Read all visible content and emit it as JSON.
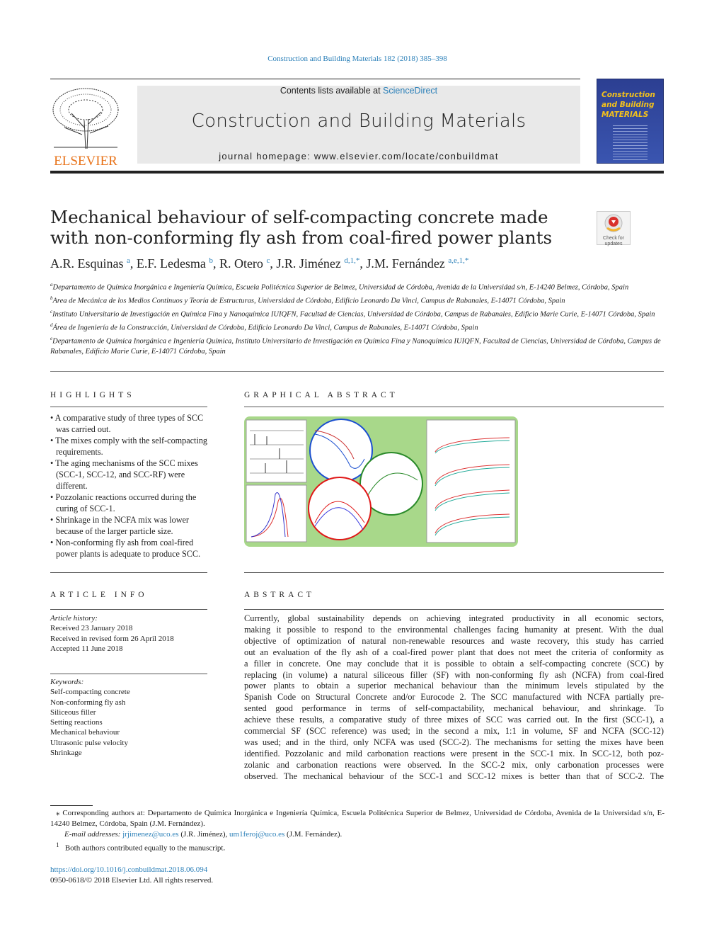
{
  "citation": "Construction and Building Materials 182 (2018) 385–398",
  "header": {
    "contents_prefix": "Contents lists available at ",
    "sciencedirect": "ScienceDirect",
    "journal_title": "Construction and Building Materials",
    "homepage": "journal homepage: www.elsevier.com/locate/conbuildmat",
    "publisher": "ELSEVIER",
    "cover_title": "Construction and Building MATERIALS",
    "updates_badge": "Check for updates"
  },
  "article": {
    "title_line1": "Mechanical behaviour of self-compacting concrete made",
    "title_line2": "with non-conforming fly ash from coal-fired power plants",
    "authors": [
      {
        "name": "A.R. Esquinas",
        "sup": "a"
      },
      {
        "name": "E.F. Ledesma",
        "sup": "b"
      },
      {
        "name": "R. Otero",
        "sup": "c"
      },
      {
        "name": "J.R. Jiménez",
        "sup": "d,1,*"
      },
      {
        "name": "J.M. Fernández",
        "sup": "a,e,1,*"
      }
    ],
    "affiliations": [
      {
        "sup": "a",
        "text": "Departamento de Química Inorgánica e Ingeniería Química, Escuela Politécnica Superior de Belmez, Universidad de Córdoba, Avenida de la Universidad s/n, E-14240 Belmez, Córdoba, Spain"
      },
      {
        "sup": "b",
        "text": "Area de Mecánica de los Medios Continuos y Teoría de Estructuras, Universidad de Córdoba, Edificio Leonardo Da Vinci, Campus de Rabanales, E-14071 Córdoba, Spain"
      },
      {
        "sup": "c",
        "text": "Instituto Universitario de Investigación en Química Fina y Nanoquímica IUIQFN, Facultad de Ciencias, Universidad de Córdoba, Campus de Rabanales, Edificio Marie Curie, E-14071 Córdoba, Spain"
      },
      {
        "sup": "d",
        "text": "Área de Ingeniería de la Construcción, Universidad de Córdoba, Edificio Leonardo Da Vinci, Campus de Rabanales, E-14071 Córdoba, Spain"
      },
      {
        "sup": "e",
        "text": "Departamento de Química Inorgánica e Ingeniería Química, Instituto Universitario de Investigación en Química Fina y Nanoquímica IUIQFN, Facultad de Ciencias, Universidad de Córdoba, Campus de Rabanales, Edificio Marie Curie, E-14071 Córdoba, Spain"
      }
    ]
  },
  "highlights": {
    "heading": "HIGHLIGHTS",
    "items": [
      "A comparative study of three types of SCC was carried out.",
      "The mixes comply with the self-compacting requirements.",
      "The aging mechanisms of the SCC mixes (SCC-1, SCC-12, and SCC-RF) were different.",
      "Pozzolanic reactions occurred during the curing of SCC-1.",
      "Shrinkage in the NCFA mix was lower because of the larger particle size.",
      "Non-conforming fly ash from coal-fired power plants is adequate to produce SCC."
    ]
  },
  "graphical_abstract": {
    "heading": "GRAPHICAL ABSTRACT",
    "background_color": "#a8d88a"
  },
  "article_info": {
    "heading": "ARTICLE INFO",
    "history_label": "Article history:",
    "history": [
      "Received 23 January 2018",
      "Received in revised form 26 April 2018",
      "Accepted 11 June 2018"
    ],
    "keywords_label": "Keywords:",
    "keywords": [
      "Self-compacting concrete",
      "Non-conforming fly ash",
      "Siliceous filler",
      "Setting reactions",
      "Mechanical behaviour",
      "Ultrasonic pulse velocity",
      "Shrinkage"
    ]
  },
  "abstract": {
    "heading": "ABSTRACT",
    "lines": [
      "Currently, global sustainability depends on achieving integrated productivity in all economic sectors,",
      "making it possible to respond to the environmental challenges facing humanity at present. With the dual",
      "objective of optimization of natural non-renewable resources and waste recovery, this study has carried",
      "out an evaluation of the fly ash of a coal-fired power plant that does not meet the criteria of conformity as",
      "a filler in concrete. One may conclude that it is possible to obtain a self-compacting concrete (SCC) by",
      "replacing (in volume) a natural siliceous filler (SF) with non-conforming fly ash (NCFA) from coal-fired",
      "power plants to obtain a superior mechanical behaviour than the minimum levels stipulated by the",
      "Spanish Code on Structural Concrete and/or Eurocode 2. The SCC manufactured with NCFA partially pre-",
      "sented good performance in terms of self-compactability, mechanical behaviour, and shrinkage. To",
      "achieve these results, a comparative study of three mixes of SCC was carried out. In the first (SCC-1), a",
      "commercial SF (SCC reference) was used; in the second a mix, 1:1 in volume, SF and NCFA (SCC-12)",
      "was used; and in the third, only NCFA was used (SCC-2). The mechanisms for setting the mixes have been",
      "identified. Pozzolanic and mild carbonation reactions were present in the SCC-1 mix. In SCC-12, both poz-",
      "zolanic and carbonation reactions were observed. In the SCC-2 mix, only carbonation processes were",
      "observed. The mechanical behaviour of the SCC-1 and SCC-12 mixes is better than that of SCC-2. The"
    ]
  },
  "footnotes": {
    "corresponding": "Corresponding authors at: Departamento de Química Inorgánica e Ingeniería Química, Escuela Politécnica Superior de Belmez, Universidad de Córdoba, Avenida de la Universidad s/n, E-14240 Belmez, Córdoba, Spain (J.M. Fernández).",
    "email_label": "E-mail addresses:",
    "email1": "jrjimenez@uco.es",
    "email1_owner": " (J.R. Jiménez), ",
    "email2": "um1feroj@uco.es",
    "email2_owner": " (J.M. Fernández).",
    "note1": "Both authors contributed equally to the manuscript.",
    "doi": "https://doi.org/10.1016/j.conbuildmat.2018.06.094",
    "copyright": "0950-0618/© 2018 Elsevier Ltd. All rights reserved."
  }
}
